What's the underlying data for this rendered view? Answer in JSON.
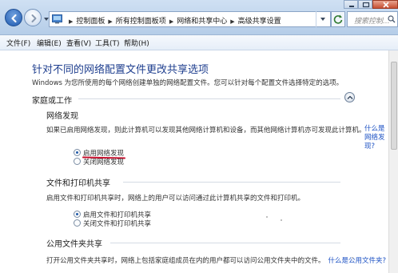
{
  "window": {
    "breadcrumbs": [
      "控制面板",
      "所有控制面板项",
      "网络和共享中心",
      "高级共享设置"
    ],
    "search_placeholder": "搜索控制..."
  },
  "menu": {
    "items": [
      "文件(F)",
      "编辑(E)",
      "查看(V)",
      "工具(T)",
      "帮助(H)"
    ]
  },
  "main": {
    "title": "针对不同的网络配置文件更改共享选项",
    "description": "Windows 为您所使用的每个网络创建单独的网络配置文件。您可以针对每个配置文件选择特定的选项。",
    "profile": {
      "label": "家庭或工作"
    },
    "network_discovery": {
      "heading": "网络发现",
      "description": "如果已启用网络发现，则此计算机可以发现其他网络计算机和设备，而其他网络计算机亦可发现此计算机。",
      "link": "什么是网络发现?",
      "options": [
        "启用网络发现",
        "关闭网络发现"
      ],
      "selected": 0
    },
    "file_printer_sharing": {
      "heading": "文件和打印机共享",
      "description": "启用文件和打印机共享时，网络上的用户可以访问通过此计算机共享的文件和打印机。",
      "options": [
        "启用文件和打印机共享",
        "关闭文件和打印机共享"
      ],
      "selected": 0
    },
    "public_folder_sharing": {
      "heading": "公用文件夹共享",
      "description": "打开公用文件夹共享时，网络上包括家庭组成员在内的用户都可以访问公用文件夹中的文件。",
      "link": "什么是公用文件夹?"
    }
  },
  "colors": {
    "title_blue": "#1f3f8f",
    "link_blue": "#1d52c4",
    "annotation_red": "#c8102e"
  }
}
